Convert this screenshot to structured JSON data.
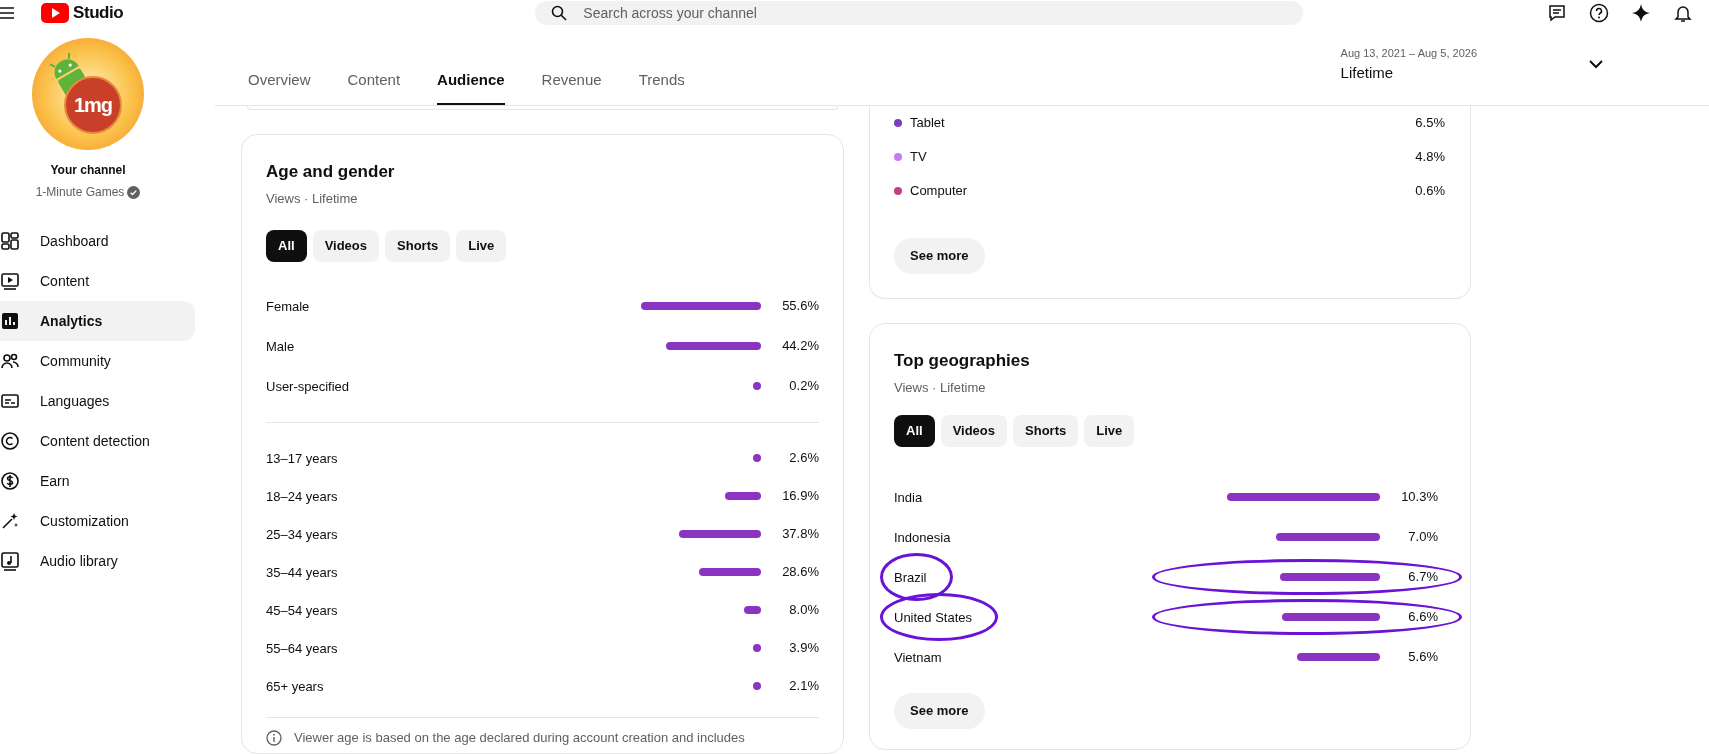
{
  "topbar": {
    "logo_text": "Studio",
    "search": {
      "placeholder": "Search across your channel"
    }
  },
  "channel": {
    "avatar_text": "1mg",
    "label": "Your channel",
    "name": "1-Minute Games",
    "verified": true
  },
  "sidebar": {
    "items": [
      {
        "label": "Dashboard",
        "selected": false
      },
      {
        "label": "Content",
        "selected": false
      },
      {
        "label": "Analytics",
        "selected": true
      },
      {
        "label": "Community",
        "selected": false
      },
      {
        "label": "Languages",
        "selected": false
      },
      {
        "label": "Content detection",
        "selected": false
      },
      {
        "label": "Earn",
        "selected": false
      },
      {
        "label": "Customization",
        "selected": false
      },
      {
        "label": "Audio library",
        "selected": false
      }
    ]
  },
  "tabs": [
    {
      "label": "Overview",
      "selected": false
    },
    {
      "label": "Content",
      "selected": false
    },
    {
      "label": "Audience",
      "selected": true
    },
    {
      "label": "Revenue",
      "selected": false
    },
    {
      "label": "Trends",
      "selected": false
    }
  ],
  "date_range": {
    "dates": "Aug 13, 2021 – Aug 5, 2026",
    "period": "Lifetime"
  },
  "age_gender": {
    "title": "Age and gender",
    "subtitle": "Views · Lifetime",
    "filters": [
      {
        "label": "All",
        "selected": true
      },
      {
        "label": "Videos",
        "selected": false
      },
      {
        "label": "Shorts",
        "selected": false
      },
      {
        "label": "Live",
        "selected": false
      }
    ],
    "gender_rows": [
      {
        "label": "Female",
        "value": "55.6%"
      },
      {
        "label": "Male",
        "value": "44.2%"
      },
      {
        "label": "User-specified",
        "value": "0.2%"
      }
    ],
    "age_rows": [
      {
        "label": "13–17 years",
        "value": "2.6%"
      },
      {
        "label": "18–24 years",
        "value": "16.9%"
      },
      {
        "label": "25–34 years",
        "value": "37.8%"
      },
      {
        "label": "35–44 years",
        "value": "28.6%"
      },
      {
        "label": "45–54 years",
        "value": "8.0%"
      },
      {
        "label": "55–64 years",
        "value": "3.9%"
      },
      {
        "label": "65+ years",
        "value": "2.1%"
      }
    ],
    "note": "Viewer age is based on the age declared during account creation and includes"
  },
  "devices": {
    "rows": [
      {
        "label": "Tablet",
        "value": "6.5%",
        "color": "#7b3fbf"
      },
      {
        "label": "TV",
        "value": "4.8%",
        "color": "#c67bf0"
      },
      {
        "label": "Computer",
        "value": "0.6%",
        "color": "#c2407f"
      }
    ],
    "see_more": "See more"
  },
  "geographies": {
    "title": "Top geographies",
    "subtitle": "Views · Lifetime",
    "filters": [
      {
        "label": "All",
        "selected": true
      },
      {
        "label": "Videos",
        "selected": false
      },
      {
        "label": "Shorts",
        "selected": false
      },
      {
        "label": "Live",
        "selected": false
      }
    ],
    "rows": [
      {
        "label": "India",
        "value": "10.3%",
        "circled": false
      },
      {
        "label": "Indonesia",
        "value": "7.0%",
        "circled": false
      },
      {
        "label": "Brazil",
        "value": "6.7%",
        "circled": true
      },
      {
        "label": "United States",
        "value": "6.6%",
        "circled": true
      },
      {
        "label": "Vietnam",
        "value": "5.6%",
        "circled": false
      }
    ],
    "see_more": "See more"
  }
}
